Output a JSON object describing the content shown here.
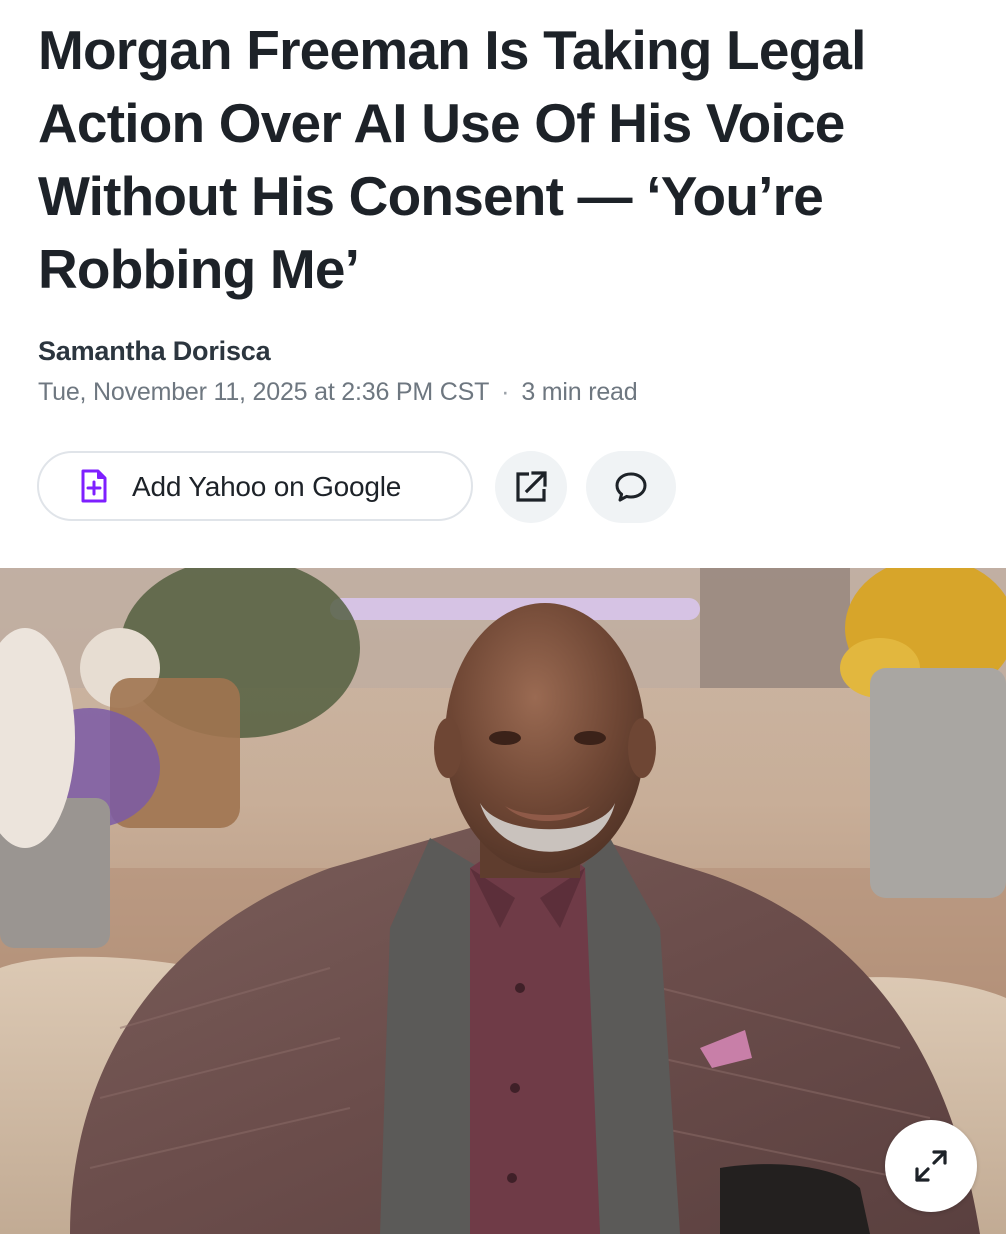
{
  "article": {
    "headline": "Morgan Freeman Is Taking Legal Action Over AI Use Of His Voice Without His Consent — ‘You’re Robbing Me’",
    "author": "Samantha Dorisca",
    "date": "Tue, November 11, 2025 at 2:36 PM CST",
    "separator": "·",
    "read_time": "3 min read"
  },
  "actions": {
    "add_source_label": "Add Yahoo on Google",
    "add_source_icon": "document-plus-icon",
    "share_icon": "share-external-icon",
    "comment_icon": "comment-bubble-icon"
  },
  "photo": {
    "expand_icon": "expand-arrows-icon"
  },
  "colors": {
    "text": "#1d2228",
    "meta": "#6e7780",
    "accent_purple": "#7e1fff",
    "button_bg": "#f0f3f5"
  }
}
